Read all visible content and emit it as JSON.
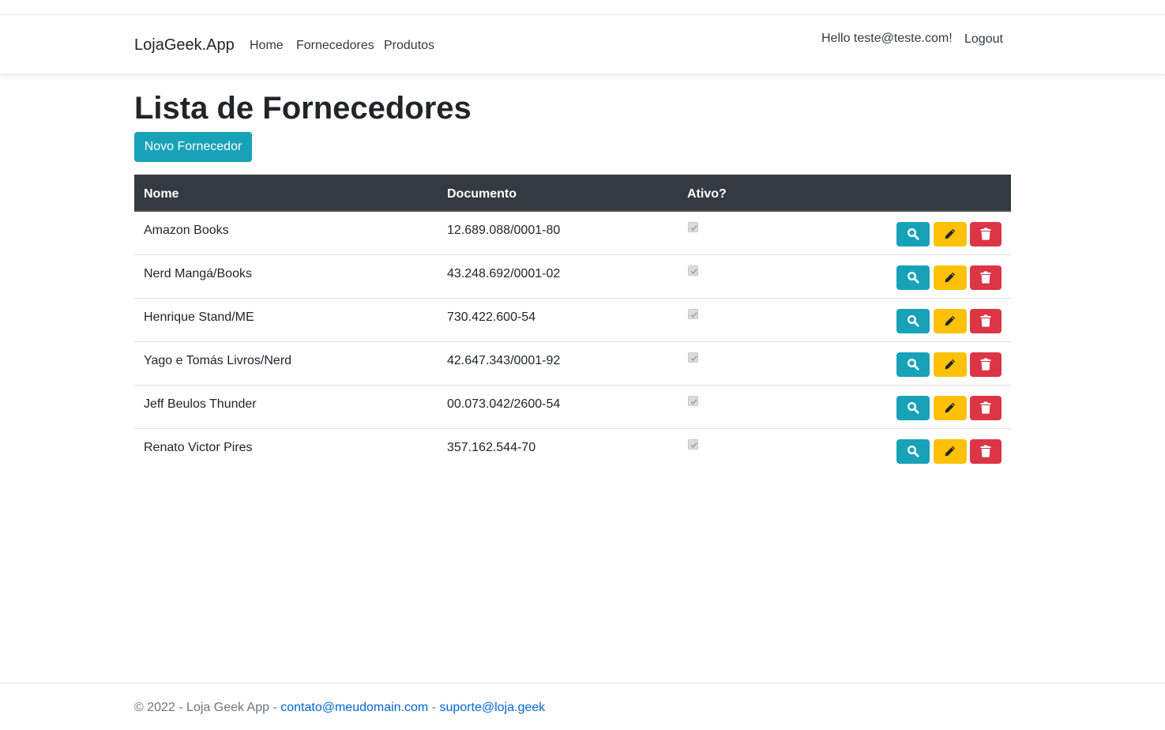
{
  "nav": {
    "brand": "LojaGeek.App",
    "items": [
      {
        "label": "Home"
      },
      {
        "label": "Fornecedores"
      },
      {
        "label": "Produtos"
      }
    ],
    "greeting": "Hello teste@teste.com!",
    "logout": "Logout"
  },
  "page": {
    "title": "Lista de Fornecedores",
    "new_button": "Novo Fornecedor"
  },
  "table": {
    "headers": [
      "Nome",
      "Documento",
      "Ativo?"
    ],
    "rows": [
      {
        "nome": "Amazon Books",
        "documento": "12.689.088/0001-80",
        "ativo": true
      },
      {
        "nome": "Nerd Mangá/Books",
        "documento": "43.248.692/0001-02",
        "ativo": true
      },
      {
        "nome": "Henrique Stand/ME",
        "documento": "730.422.600-54",
        "ativo": true
      },
      {
        "nome": "Yago e Tomás Livros/Nerd",
        "documento": "42.647.343/0001-92",
        "ativo": true
      },
      {
        "nome": "Jeff Beulos Thunder",
        "documento": "00.073.042/2600-54",
        "ativo": true
      },
      {
        "nome": "Renato Victor Pires",
        "documento": "357.162.544-70",
        "ativo": true
      }
    ],
    "action_icons": [
      "search-icon",
      "pencil-icon",
      "trash-icon"
    ]
  },
  "footer": {
    "prefix": "© 2022 - Loja Geek App -",
    "email1": "contato@meudomain.com",
    "separator": "-",
    "email2": "suporte@loja.geek"
  },
  "colors": {
    "info": "#17a2b8",
    "warning": "#ffc107",
    "danger": "#dc3545",
    "table_header": "#343a40",
    "link": "#0366d6"
  }
}
